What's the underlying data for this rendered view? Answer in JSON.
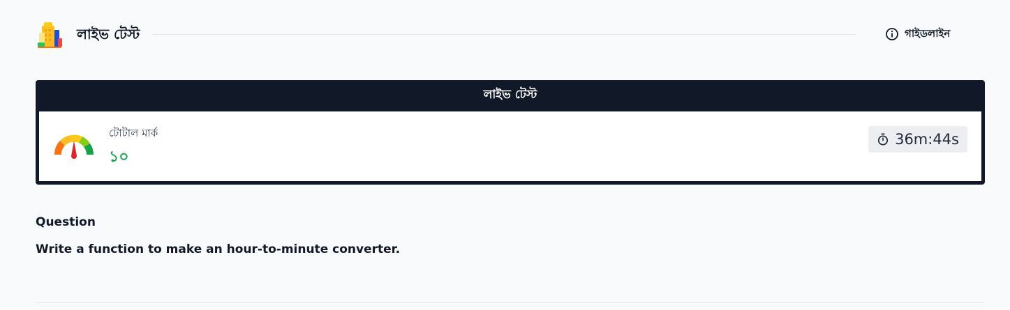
{
  "header": {
    "title": "লাইভ টেস্ট",
    "logo_icon": "building-icon",
    "guideline_label": "গাইডলাইন",
    "guideline_icon": "info-icon"
  },
  "card": {
    "title": "লাইভ টেস্ট",
    "total_mark_label": "টোটাল মার্ক",
    "total_mark_value": "১০",
    "gauge_icon": "gauge-icon",
    "timer_icon": "stopwatch-icon",
    "timer_value": "36m:44s"
  },
  "question": {
    "heading": "Question",
    "text": "Write a function to make an hour-to-minute converter."
  },
  "colors": {
    "card_header_bg": "#111827",
    "mark_value": "#16a34a",
    "timer_bg": "#eceef1"
  }
}
